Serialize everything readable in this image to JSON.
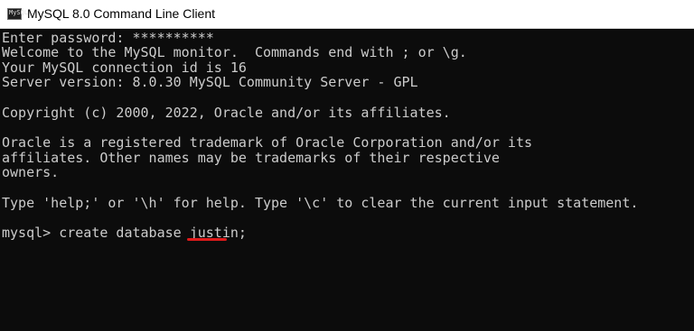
{
  "window": {
    "title": "MySQL 8.0 Command Line Client",
    "icon": "mysql-console-icon",
    "icon_text": "MySQL"
  },
  "console": {
    "lines": [
      "Enter password: **********",
      "Welcome to the MySQL monitor.  Commands end with ; or \\g.",
      "Your MySQL connection id is 16",
      "Server version: 8.0.30 MySQL Community Server - GPL",
      "",
      "Copyright (c) 2000, 2022, Oracle and/or its affiliates.",
      "",
      "Oracle is a registered trademark of Oracle Corporation and/or its",
      "affiliates. Other names may be trademarks of their respective",
      "owners.",
      "",
      "Type 'help;' or '\\h' for help. Type '\\c' to clear the current input statement.",
      "",
      "mysql> create database justin;"
    ]
  },
  "colors": {
    "console_bg": "#0c0c0c",
    "console_text": "#cccccc",
    "annotation": "#e01b1b"
  }
}
